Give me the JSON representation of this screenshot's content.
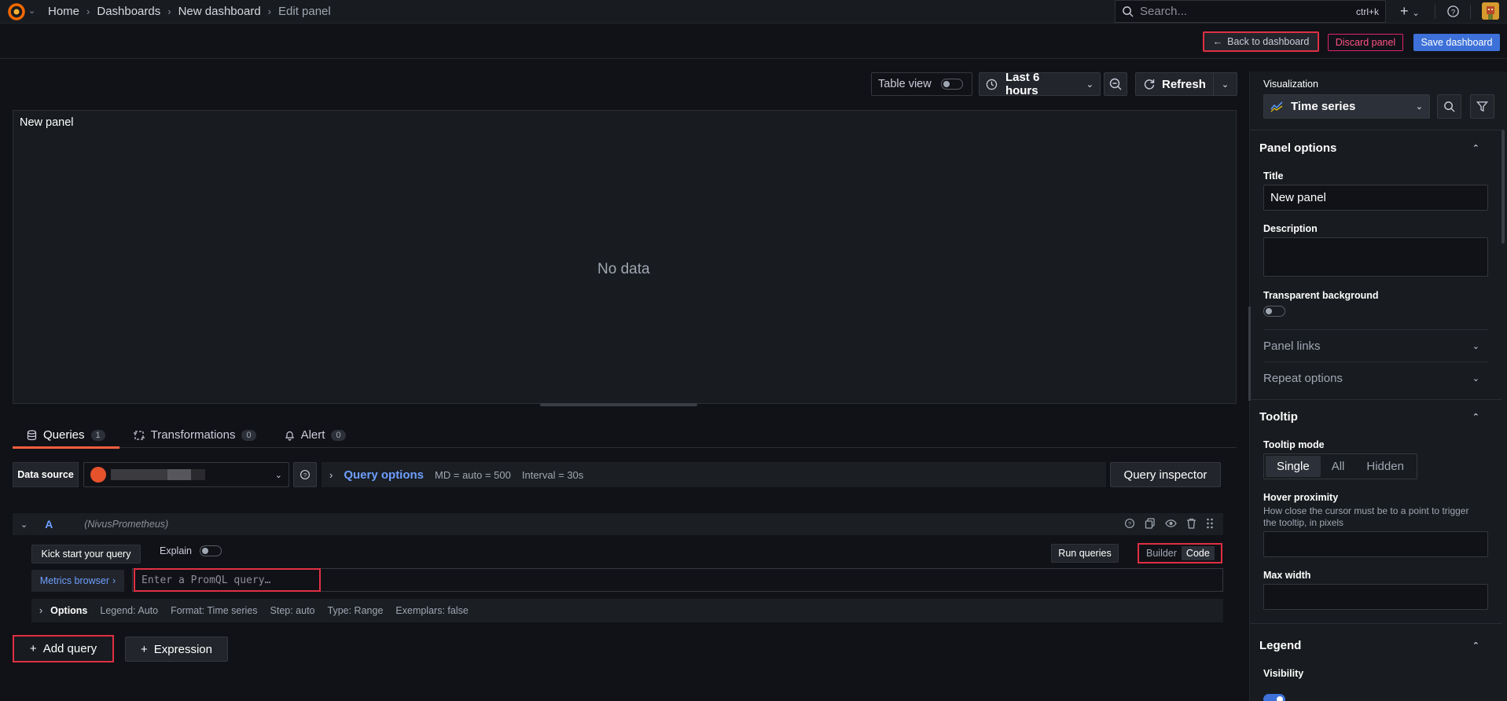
{
  "topbar": {
    "breadcrumbs": [
      "Home",
      "Dashboards",
      "New dashboard",
      "Edit panel"
    ],
    "search_placeholder": "Search...",
    "search_shortcut": "ctrl+k",
    "plus": "+"
  },
  "actions": {
    "back": "Back to dashboard",
    "discard": "Discard panel",
    "save": "Save dashboard"
  },
  "panel_toolbar": {
    "table_view": "Table view",
    "time_range": "Last 6 hours",
    "refresh": "Refresh"
  },
  "panel": {
    "title": "New panel",
    "empty_message": "No data"
  },
  "tabs": [
    {
      "label": "Queries",
      "count": "1"
    },
    {
      "label": "Transformations",
      "count": "0"
    },
    {
      "label": "Alert",
      "count": "0"
    }
  ],
  "datasource": {
    "label": "Data source",
    "query_options": "Query options",
    "md": "MD = auto = 500",
    "interval": "Interval = 30s",
    "inspector": "Query inspector"
  },
  "query": {
    "letter": "A",
    "datasource_name": "(NivusPrometheus)",
    "kick_start": "Kick start your query",
    "explain": "Explain",
    "run": "Run queries",
    "builder": "Builder",
    "code": "Code",
    "metrics_browser": "Metrics browser",
    "placeholder": "Enter a PromQL query…",
    "options": {
      "label": "Options",
      "legend": "Legend: Auto",
      "format": "Format: Time series",
      "step": "Step: auto",
      "type": "Type: Range",
      "exemplars": "Exemplars: false"
    },
    "add_query": "Add query",
    "expression": "Expression"
  },
  "sidebar": {
    "visualization_label": "Visualization",
    "visualization": "Time series",
    "panel_options": {
      "heading": "Panel options",
      "title_label": "Title",
      "title_value": "New panel",
      "description_label": "Description",
      "transparent_label": "Transparent background",
      "panel_links": "Panel links",
      "repeat_options": "Repeat options"
    },
    "tooltip": {
      "heading": "Tooltip",
      "mode_label": "Tooltip mode",
      "modes": [
        "Single",
        "All",
        "Hidden"
      ],
      "hover_label": "Hover proximity",
      "hover_desc": "How close the cursor must be to a point to trigger the tooltip, in pixels",
      "max_width_label": "Max width"
    },
    "legend": {
      "heading": "Legend",
      "visibility_label": "Visibility"
    }
  },
  "colors": {
    "accent": "#3d71d9",
    "danger": "#e02f44",
    "brand": "#f55f3e"
  }
}
